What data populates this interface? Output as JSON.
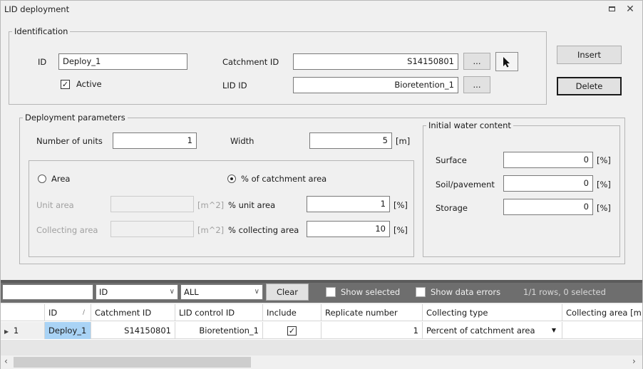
{
  "window": {
    "title": "LID deployment"
  },
  "identification": {
    "legend": "Identification",
    "id_label": "ID",
    "id_value": "Deploy_1",
    "active_label": "Active",
    "active_checked": true,
    "catchment_label": "Catchment ID",
    "catchment_value": "S14150801",
    "lid_label": "LID ID",
    "lid_value": "Bioretention_1",
    "browse_label": "..."
  },
  "actions": {
    "insert": "Insert",
    "delete": "Delete"
  },
  "deployment": {
    "legend": "Deployment parameters",
    "units_label": "Number of units",
    "units_value": "1",
    "width_label": "Width",
    "width_value": "5",
    "width_unit": "[m]",
    "area_option": "Area",
    "pct_option": "% of catchment area",
    "selected_option": "pct",
    "unit_area_label": "Unit area",
    "unit_area_unit": "[m^2]",
    "collecting_area_label": "Collecting area",
    "collecting_area_unit": "[m^2]",
    "pct_unit_area_label": "% unit area",
    "pct_unit_area_value": "1",
    "pct_unit_area_unit": "[%]",
    "pct_collecting_label": "% collecting area",
    "pct_collecting_value": "10",
    "pct_collecting_unit": "[%]"
  },
  "initial_water": {
    "legend": "Initial water content",
    "surface_label": "Surface",
    "surface_value": "0",
    "soil_label": "Soil/pavement",
    "soil_value": "0",
    "storage_label": "Storage",
    "storage_value": "0",
    "unit": "[%]"
  },
  "filter": {
    "search_value": "",
    "field_select": "ID",
    "mode_select": "ALL",
    "clear_label": "Clear",
    "show_selected_label": "Show selected",
    "show_errors_label": "Show data errors",
    "status": "1/1 rows, 0 selected"
  },
  "table": {
    "columns": [
      "ID",
      "Catchment ID",
      "LID control ID",
      "Include",
      "Replicate number",
      "Collecting type",
      "Collecting area [m"
    ],
    "sort_indicator": "/",
    "rows": [
      {
        "row_num": "1",
        "id": "Deploy_1",
        "catchment": "S14150801",
        "lid_control": "Bioretention_1",
        "include": true,
        "replicate": "1",
        "collecting_type": "Percent of catchment area",
        "collecting_area": ""
      }
    ]
  },
  "colors": {
    "selected_cell": "#a9d3f5",
    "filter_bar": "#6e6e6e"
  }
}
